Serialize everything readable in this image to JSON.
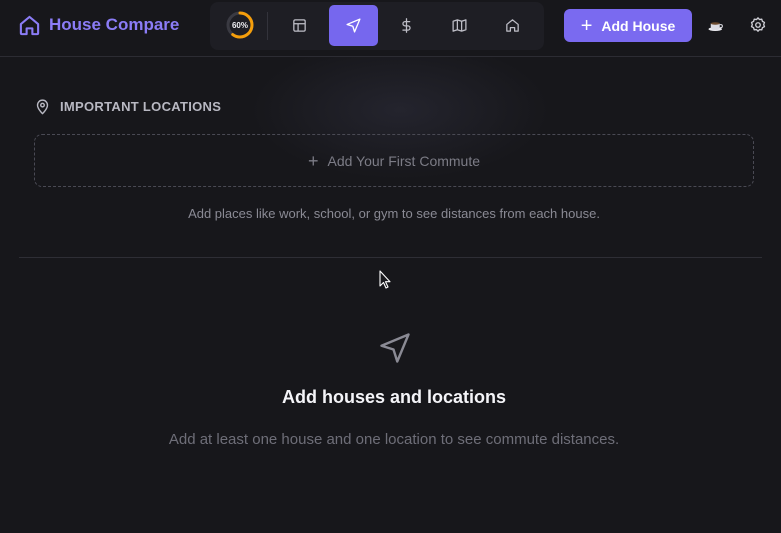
{
  "header": {
    "brand_title": "House Compare",
    "progress": {
      "value": 60,
      "label": "60%"
    },
    "nav_tabs": [
      {
        "name": "table",
        "icon": "table-icon",
        "active": false
      },
      {
        "name": "commute",
        "icon": "navigation-arrow-icon",
        "active": true
      },
      {
        "name": "cost",
        "icon": "dollar-icon",
        "active": false
      },
      {
        "name": "map",
        "icon": "map-icon",
        "active": false
      },
      {
        "name": "home",
        "icon": "home-icon",
        "active": false
      }
    ],
    "add_house_label": "Add House"
  },
  "locations": {
    "section_title": "IMPORTANT LOCATIONS",
    "add_commute_label": "Add Your First Commute",
    "helper_text": "Add places like work, school, or gym to see distances from each house."
  },
  "empty_state": {
    "title": "Add houses and locations",
    "description": "Add at least one house and one location to see commute distances."
  },
  "colors": {
    "accent": "#7a6af0",
    "brand": "#8b7cf6",
    "progress": "#f59e0b",
    "background": "#17171b"
  }
}
